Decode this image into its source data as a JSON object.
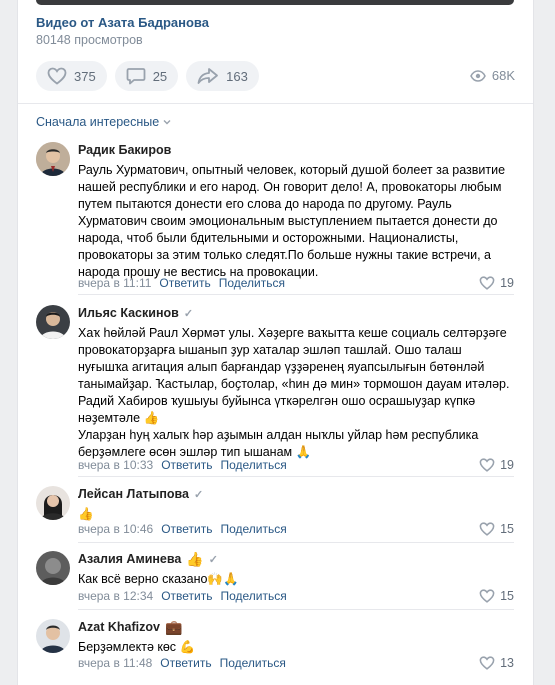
{
  "video": {
    "title": "Видео от Азата Бадранова",
    "views": "80148 просмотров",
    "likes": "375",
    "comments": "25",
    "shares": "163",
    "view_count": "68K"
  },
  "sort_label": "Сначала интересные",
  "comments": [
    {
      "author": "Радик Бакиров",
      "text": "Рауль Хурматович, опытный человек, который душой болеет за развитие нашей республики и его народ. Он говорит дело! А, провокаторы любым путем пытаются донести его слова до народа по другому. Рауль Хурматович своим эмоциональным выступлением пытается донести до народа, чтоб были бдительными и осторожными. Националисты, провокаторы за этим только следят.По больше нужны такие встречи, а народа прошу не вестись на провокации.",
      "time": "вчера в 11:11",
      "reply": "Ответить",
      "share": "Поделиться",
      "likes": "19"
    },
    {
      "author": "Ильяс Каскинов",
      "text": "Хаҡ һөйләй Раuл Хөрмәт улы. Хәҙерге ваҡытта кеше социаль селтәрҙәге провокаторҙарға ышанып ҙур хаталар эшләп ташлай. Ошо талаш нуғышҡа агитация алып барғандар үҙҙәренең яуапсылығын бөтөнләй танымайҙар. Ҡастылар, боҫтолар, «һин дә мин» тормошон дауам итәләр.\nРадий Хабиров ҡушыуы буйынса үткәрелгән ошо осрашыуҙар күпкә нәҙемтәле 👍\nУларҙан һуң халыҡ һәр аҙымын алдан ныҡлы уйлар һәм республика берҙәмлеге өсөн эшләр тип ышанам 🙏",
      "time": "вчера в 10:33",
      "reply": "Ответить",
      "share": "Поделиться",
      "likes": "19"
    },
    {
      "author": "Лейсан Латыпова",
      "text": "👍",
      "time": "вчера в 10:46",
      "reply": "Ответить",
      "share": "Поделиться",
      "likes": "15"
    },
    {
      "author": "Азалия Аминева",
      "author_emoji": "👍",
      "text": "Как всё верно сказано🙌🙏",
      "time": "вчера в 12:34",
      "reply": "Ответить",
      "share": "Поделиться",
      "likes": "15"
    },
    {
      "author": "Azat Khafizov",
      "author_emoji": "💼",
      "text": "Берҙәмлектә көс 💪",
      "time": "вчера в 11:48",
      "reply": "Ответить",
      "share": "Поделиться",
      "likes": "13"
    }
  ]
}
